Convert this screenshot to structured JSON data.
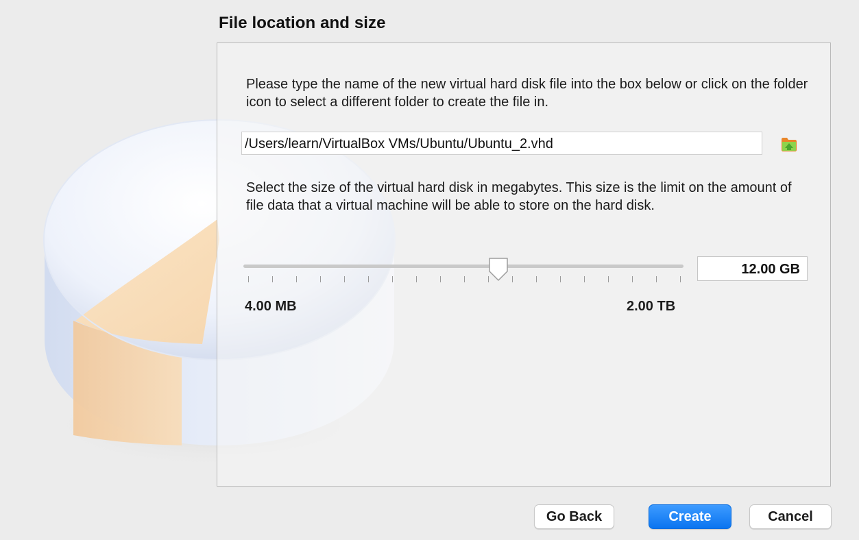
{
  "page": {
    "title": "File location and size"
  },
  "location": {
    "description": "Please type the name of the new virtual hard disk file into the box below or click on the folder icon to select a different folder to create the file in.",
    "path_value": "/Users/learn/VirtualBox VMs/Ubuntu/Ubuntu_2.vhd",
    "folder_icon": "folder-up-icon"
  },
  "size": {
    "description": "Select the size of the virtual hard disk in megabytes. This size is the limit on the amount of file data that a virtual machine will be able to store on the hard disk.",
    "value": "12.00 GB",
    "min_label": "4.00 MB",
    "max_label": "2.00 TB",
    "tick_count": 19,
    "slider_level": 0.58
  },
  "buttons": {
    "back": "Go Back",
    "create": "Create",
    "cancel": "Cancel"
  },
  "colors": {
    "accent": "#0a74f0",
    "disk_slice": "#f6d3a6",
    "disk_body": "#dde6f6"
  }
}
